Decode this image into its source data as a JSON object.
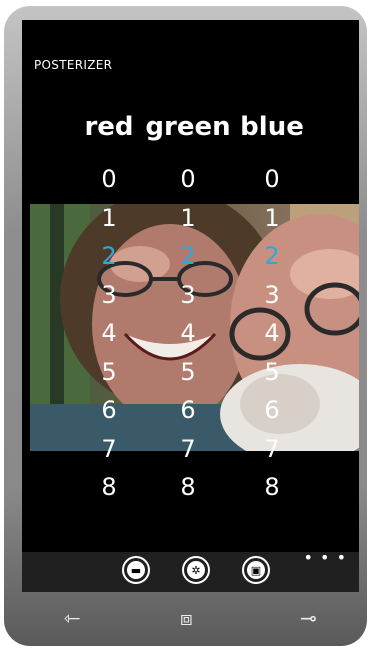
{
  "app": {
    "title": "POSTERIZER"
  },
  "columns": [
    {
      "header": "red",
      "values": [
        "0",
        "1",
        "2",
        "3",
        "4",
        "5",
        "6",
        "7",
        "8"
      ],
      "selected": "2"
    },
    {
      "header": "green",
      "values": [
        "0",
        "1",
        "2",
        "3",
        "4",
        "5",
        "6",
        "7",
        "8"
      ],
      "selected": "2"
    },
    {
      "header": "blue",
      "values": [
        "0",
        "1",
        "2",
        "3",
        "4",
        "5",
        "6",
        "7",
        "8"
      ],
      "selected": "2"
    }
  ],
  "colors": {
    "selected": "#2aa8e0",
    "background": "#000000",
    "appbar": "#202020"
  },
  "appbar": {
    "buttons": [
      {
        "icon": "folder-icon",
        "glyph": "▬"
      },
      {
        "icon": "settings-icon",
        "glyph": "✲"
      },
      {
        "icon": "save-icon",
        "glyph": "▣"
      }
    ],
    "more": "• • •"
  },
  "nav": {
    "back": "⇽",
    "windows": "⧈",
    "search": "⊸"
  }
}
